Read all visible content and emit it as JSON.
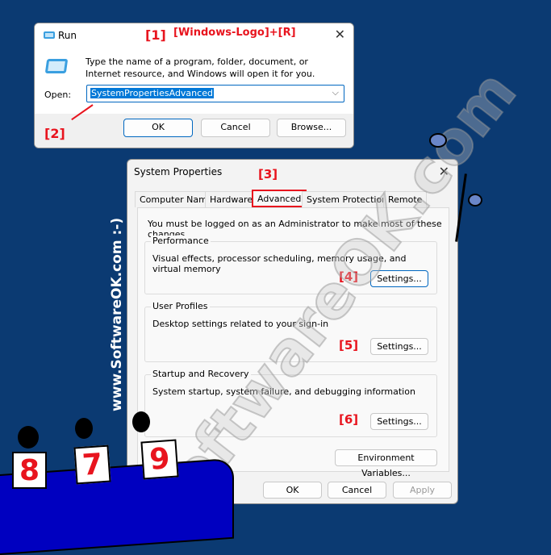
{
  "annotations": {
    "a1": "[1]",
    "a1_text": "[Windows-Logo]+[R]",
    "a2": "[2]",
    "a3": "[3]",
    "a4": "[4]",
    "a5": "[5]",
    "a6": "[6]"
  },
  "run": {
    "title": "Run",
    "description": "Type the name of a program, folder, document, or Internet resource, and Windows will open it for you.",
    "open_label": "Open:",
    "open_value": "SystemPropertiesAdvanced",
    "ok": "OK",
    "cancel": "Cancel",
    "browse": "Browse..."
  },
  "sysprops": {
    "title": "System Properties",
    "tabs": [
      "Computer Name",
      "Hardware",
      "Advanced",
      "System Protection",
      "Remote"
    ],
    "active_tab": "Advanced",
    "admin_note": "You must be logged on as an Administrator to make most of these changes.",
    "groups": [
      {
        "label": "Performance",
        "desc": "Visual effects, processor scheduling, memory usage, and virtual memory",
        "button": "Settings..."
      },
      {
        "label": "User Profiles",
        "desc": "Desktop settings related to your sign-in",
        "button": "Settings..."
      },
      {
        "label": "Startup and Recovery",
        "desc": "System startup, system failure, and debugging information",
        "button": "Settings..."
      }
    ],
    "env_button": "Environment Variables...",
    "ok": "OK",
    "cancel": "Cancel",
    "apply": "Apply"
  },
  "watermark": {
    "vertical": "www.SoftwareOK.com :-)",
    "diagonal": "SoftwareOK.com"
  },
  "scorecards": [
    "8",
    "7",
    "9"
  ],
  "colors": {
    "background": "#0b3a72",
    "accent": "#0067c0",
    "annotation": "#e8141e",
    "table": "#0000c0"
  }
}
